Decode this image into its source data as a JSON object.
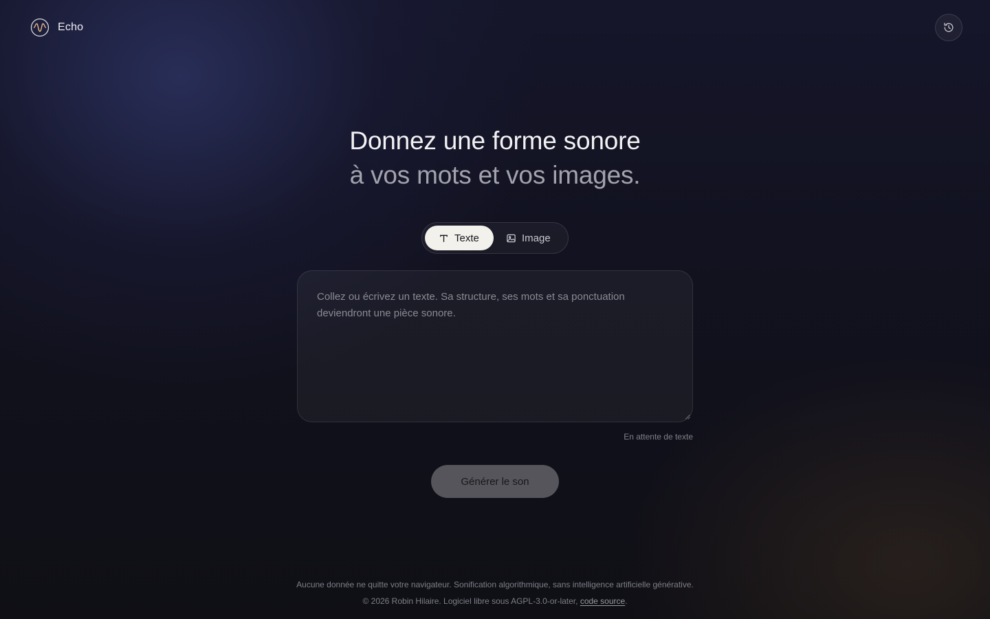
{
  "header": {
    "brand_name": "Echo",
    "logo_icon": "waveform-circle-icon",
    "history_icon": "history-icon"
  },
  "hero": {
    "line1": "Donnez une forme sonore",
    "line2": "à vos mots et vos images."
  },
  "mode_switch": {
    "selected": "text",
    "text_label": "Texte",
    "text_icon": "text-type-icon",
    "image_label": "Image",
    "image_icon": "image-icon"
  },
  "input": {
    "placeholder": "Collez ou écrivez un texte. Sa structure, ses mots et sa ponctuation deviendront une pièce sonore.",
    "value": "",
    "status": "En attente de texte"
  },
  "actions": {
    "generate_label": "Générer le son"
  },
  "footer": {
    "line1": "Aucune donnée ne quitte votre navigateur. Sonification algorithmique, sans intelligence artificielle générative.",
    "line2_prefix": "© 2026 Robin Hilaire. Logiciel libre sous AGPL-3.0-or-later, ",
    "source_link": "code source",
    "line2_suffix": "."
  },
  "colors": {
    "background": "#0f0f14",
    "accent_glow": "#2c3260",
    "active_pill": "#f2f1ec",
    "disabled_button": "#55555b"
  }
}
